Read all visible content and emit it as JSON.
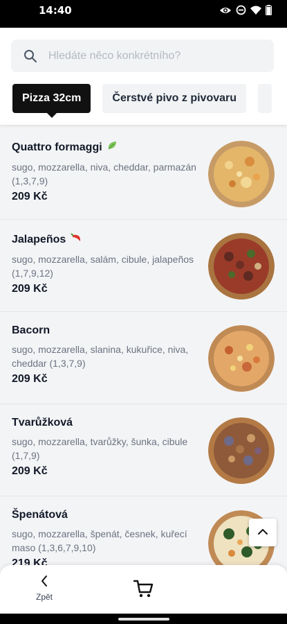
{
  "status": {
    "time": "14:40"
  },
  "search": {
    "placeholder": "Hledáte něco konkrétního?"
  },
  "tabs": [
    {
      "label": "Pizza 32cm",
      "active": true
    },
    {
      "label": "Čerstvé pivo z pivovaru",
      "active": false
    }
  ],
  "items": [
    {
      "name": "Quattro formaggi",
      "badge": "leaf-icon",
      "description": "sugo, mozzarella, niva, cheddar, parmazán (1,3,7,9)",
      "price": "209 Kč"
    },
    {
      "name": "Jalapeños",
      "badge": "chili-icon",
      "description": "sugo, mozzarella, salám, cibule, jalapeños (1,7,9,12)",
      "price": "209 Kč"
    },
    {
      "name": "Bacorn",
      "description": "sugo, mozzarella, slanina, kukuřice, niva, cheddar (1,3,7,9)",
      "price": "209 Kč"
    },
    {
      "name": "Tvarůžková",
      "description": "sugo, mozzarella, tvarůžky, šunka, cibule (1,7,9)",
      "price": "209 Kč"
    },
    {
      "name": "Špenátová",
      "description": "sugo, mozzarella, špenát, česnek, kuřecí maso (1,3,6,7,9,10)",
      "price": "219 Kč"
    }
  ],
  "bottom": {
    "back_label": "Zpět"
  },
  "colors": {
    "accent": "#111111",
    "badge_leaf": "#7cc35a",
    "badge_chili": "#e0362b"
  }
}
